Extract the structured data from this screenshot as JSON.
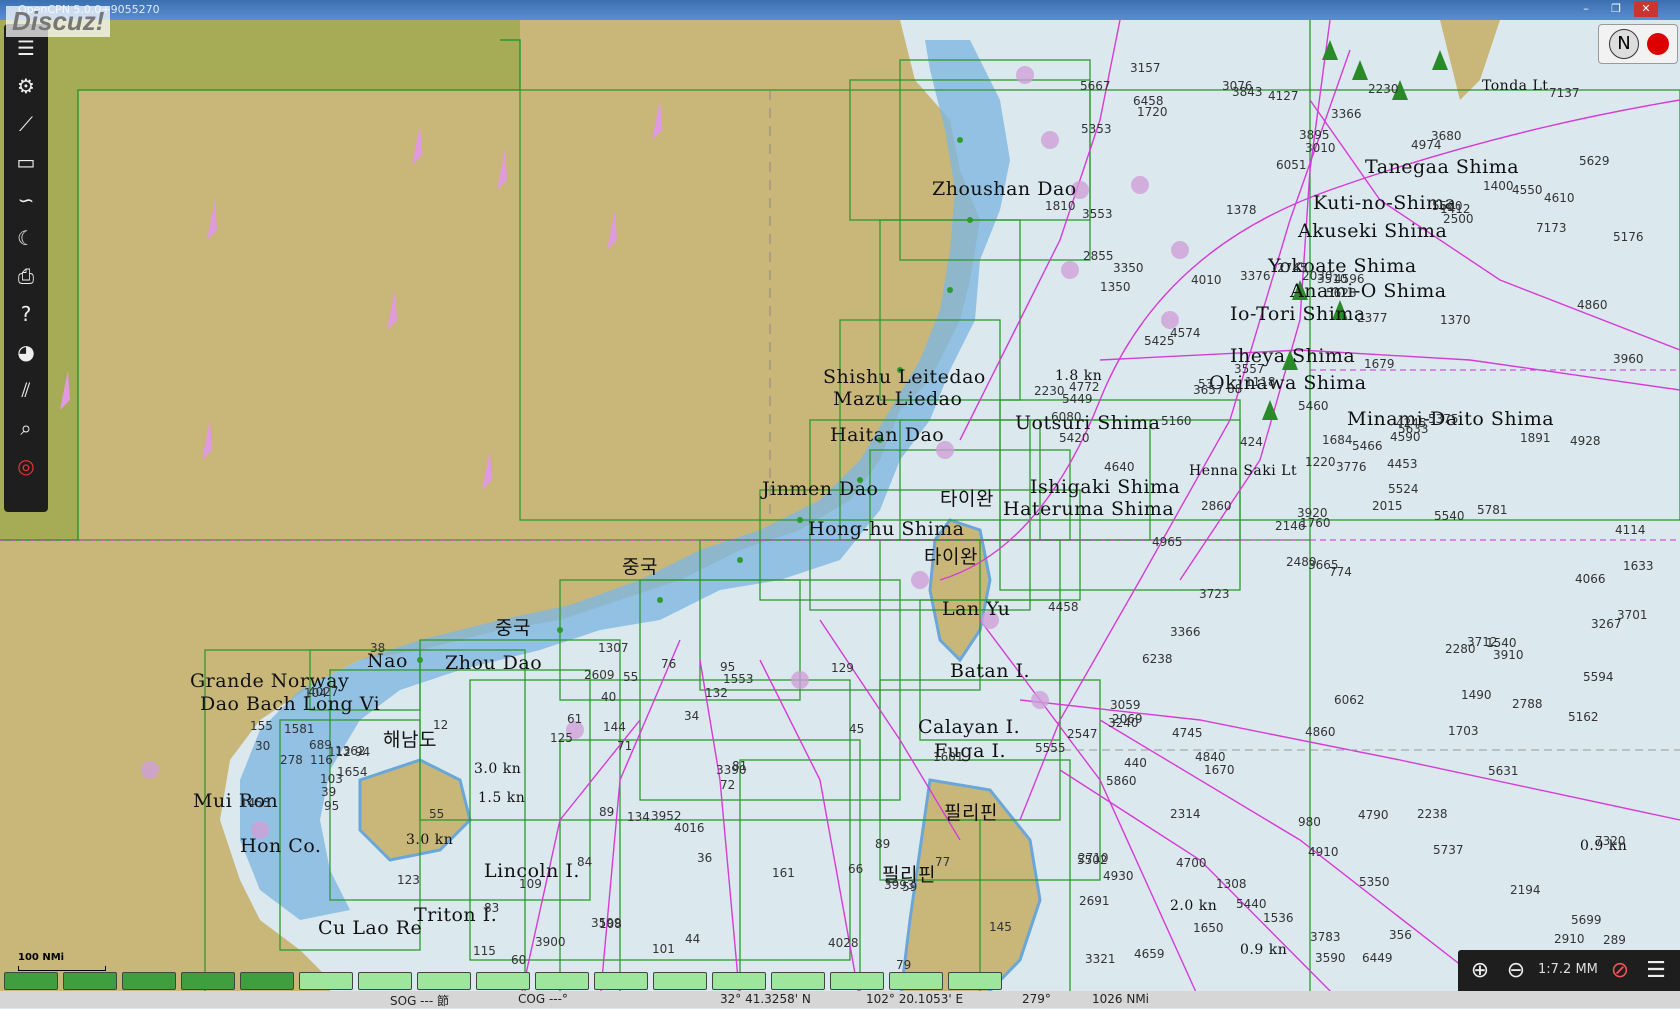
{
  "window": {
    "title": "OpenCPN 5.0.0+9055270"
  },
  "watermark": "Discuz!",
  "window_buttons": [
    "–",
    "❐",
    "✕"
  ],
  "toolbar": {
    "items": [
      {
        "name": "menu-icon",
        "glyph": "☰"
      },
      {
        "name": "settings-icon",
        "glyph": "⚙"
      },
      {
        "name": "route-icon",
        "glyph": "⟋"
      },
      {
        "name": "route-manager-icon",
        "glyph": "▭"
      },
      {
        "name": "track-icon",
        "glyph": "∽"
      },
      {
        "name": "tides-icon",
        "glyph": "☾"
      },
      {
        "name": "print-icon",
        "glyph": "⎙"
      },
      {
        "name": "help-icon",
        "glyph": "?"
      },
      {
        "name": "dashboard-icon",
        "glyph": "◕"
      },
      {
        "name": "ais-icon",
        "glyph": "⫽"
      },
      {
        "name": "chart-search-icon",
        "glyph": "⌕"
      },
      {
        "name": "mob-icon",
        "glyph": "◎"
      }
    ]
  },
  "compass": {
    "north": "N"
  },
  "chart_labels": [
    {
      "text": "Tanegaa Shima",
      "cls": ""
    },
    {
      "text": "Kuti-no-Shima",
      "cls": ""
    },
    {
      "text": "Akuseki Shima",
      "cls": ""
    },
    {
      "text": "Yokoate Shima",
      "cls": ""
    },
    {
      "text": "Anami-O Shima",
      "cls": ""
    },
    {
      "text": "Io-Tori Shima",
      "cls": ""
    },
    {
      "text": "Iheya Shima",
      "cls": ""
    },
    {
      "text": "Okinawa Shima",
      "cls": ""
    },
    {
      "text": "Minami-Daito Shima",
      "cls": ""
    },
    {
      "text": "Tonda Lt",
      "cls": "small"
    },
    {
      "text": "Henna Saki Lt",
      "cls": "small"
    },
    {
      "text": "Shishu Leitedao",
      "cls": ""
    },
    {
      "text": "Mazu Liedao",
      "cls": ""
    },
    {
      "text": "Haitan Dao",
      "cls": ""
    },
    {
      "text": "Zhoushan Dao",
      "cls": ""
    },
    {
      "text": "Jinmen Dao",
      "cls": ""
    },
    {
      "text": "Uotsuri Shima",
      "cls": ""
    },
    {
      "text": "Ishigaki Shima",
      "cls": ""
    },
    {
      "text": "Hateruma Shima",
      "cls": ""
    },
    {
      "text": "Hong-hu Shima",
      "cls": ""
    },
    {
      "text": "타이완",
      "cls": "ko"
    },
    {
      "text": "타이완",
      "cls": "ko"
    },
    {
      "text": "중국",
      "cls": "ko"
    },
    {
      "text": "중국",
      "cls": "ko"
    },
    {
      "text": "Lan Yu",
      "cls": ""
    },
    {
      "text": "Batan I.",
      "cls": ""
    },
    {
      "text": "Calayan I.",
      "cls": ""
    },
    {
      "text": "Fuga I.",
      "cls": ""
    },
    {
      "text": "필리핀",
      "cls": "ko"
    },
    {
      "text": "필리핀",
      "cls": "ko"
    },
    {
      "text": "Grande Norway",
      "cls": ""
    },
    {
      "text": "Dao Bach Long Vi",
      "cls": ""
    },
    {
      "text": "Nao",
      "cls": ""
    },
    {
      "text": "Zhou Dao",
      "cls": ""
    },
    {
      "text": "해남도",
      "cls": "ko"
    },
    {
      "text": "Mui Ron",
      "cls": ""
    },
    {
      "text": "Hon Co.",
      "cls": ""
    },
    {
      "text": "Lincoln I.",
      "cls": ""
    },
    {
      "text": "Triton I.",
      "cls": ""
    },
    {
      "text": "Cu Lao Re",
      "cls": ""
    },
    {
      "text": "3.0 kn",
      "cls": "small"
    },
    {
      "text": "1.5 kn",
      "cls": "small"
    },
    {
      "text": "3.0 kn",
      "cls": "small"
    },
    {
      "text": "2.0 kn",
      "cls": "small"
    },
    {
      "text": "0.9 kn",
      "cls": "small"
    },
    {
      "text": "0.9 kn",
      "cls": "small"
    },
    {
      "text": "1.8 kn",
      "cls": "small"
    }
  ],
  "soundings": [
    "774",
    "1350",
    "1760",
    "2710",
    "4590",
    "1670",
    "3680",
    "4596",
    "1412",
    "2015",
    "1720",
    "289",
    "4640",
    "5176",
    "2480",
    "1370",
    "4659",
    "2030",
    "1679",
    "440",
    "1118",
    "2691",
    "4700",
    "3510",
    "5633",
    "3910",
    "3350",
    "3010",
    "5420",
    "2280",
    "3960",
    "3920",
    "980",
    "1220",
    "4010",
    "1400",
    "4840",
    "2910",
    "7320",
    "1540",
    "2230",
    "88",
    "5160",
    "1703",
    "1650",
    "2230",
    "4453",
    "3321",
    "4910",
    "5524",
    "5860",
    "4860",
    "1810",
    "1490",
    "5737",
    "2314",
    "6458",
    "5667",
    "4790",
    "4610",
    "3366",
    "2860",
    "4772",
    "4574",
    "4550",
    "3157",
    "4974",
    "6051",
    "1684",
    "5555",
    "4860",
    "5440",
    "3712",
    "3657",
    "5502",
    "5353",
    "5425",
    "4458",
    "5460",
    "5350",
    "5466",
    "4930",
    "5540",
    "5594",
    "3783",
    "4928",
    "6062",
    "2194",
    "6449",
    "2238",
    "3895",
    "1633",
    "5375",
    "5631",
    "3776",
    "5162",
    "5449",
    "3590",
    "5560",
    "2500",
    "4965",
    "3076",
    "4114",
    "6080",
    "6238",
    "4745",
    "1308",
    "4245",
    "7173",
    "424",
    "4066",
    "3553",
    "5628",
    "2146",
    "3843",
    "2547",
    "3665",
    "5629",
    "2745",
    "4127",
    "3240",
    "7137",
    "2377",
    "3376",
    "5781",
    "3366",
    "5699",
    "1536",
    "1891",
    "2855",
    "2069",
    "356",
    "53",
    "1378",
    "3267",
    "2788",
    "3723",
    "3059",
    "3701",
    "3557",
    "4016",
    "1654",
    "3993",
    "3952",
    "3390",
    "4027",
    "3900",
    "4028",
    "3599",
    "2609",
    "1601",
    "12",
    "278",
    "60",
    "89",
    "76",
    "40",
    "71",
    "55",
    "34",
    "36",
    "55",
    "1455",
    "1307",
    "1553",
    "689",
    "84",
    "145",
    "38",
    "79",
    "59",
    "44",
    "30",
    "95",
    "81",
    "115",
    "132",
    "161",
    "155",
    "1362",
    "1581",
    "134",
    "101",
    "116",
    "104",
    "94",
    "112",
    "103",
    "83",
    "89",
    "77",
    "109",
    "144",
    "45",
    "72",
    "108",
    "95",
    "61",
    "66",
    "123",
    "39",
    "129",
    "125"
  ],
  "statusbar": {
    "sog": "SOG --- 節",
    "cog": "COG ---°",
    "lat": "32° 41.3258' N",
    "lon": "102° 20.1053' E",
    "brg": "279°",
    "dist": "1026 NMi"
  },
  "scalebar": {
    "label": "100 NMi"
  },
  "zoom": {
    "scale": "1:7.2 MM"
  },
  "colors": {
    "land": "#c9b77a",
    "land_dark": "#a6ab55",
    "sea": "#dbe9ee",
    "shallow": "#7fb6e0",
    "chart_outline": "#2c9a2c",
    "route": "#d63bd6",
    "piano_green": "#3f9e3f",
    "piano_light": "#9ee59e"
  }
}
